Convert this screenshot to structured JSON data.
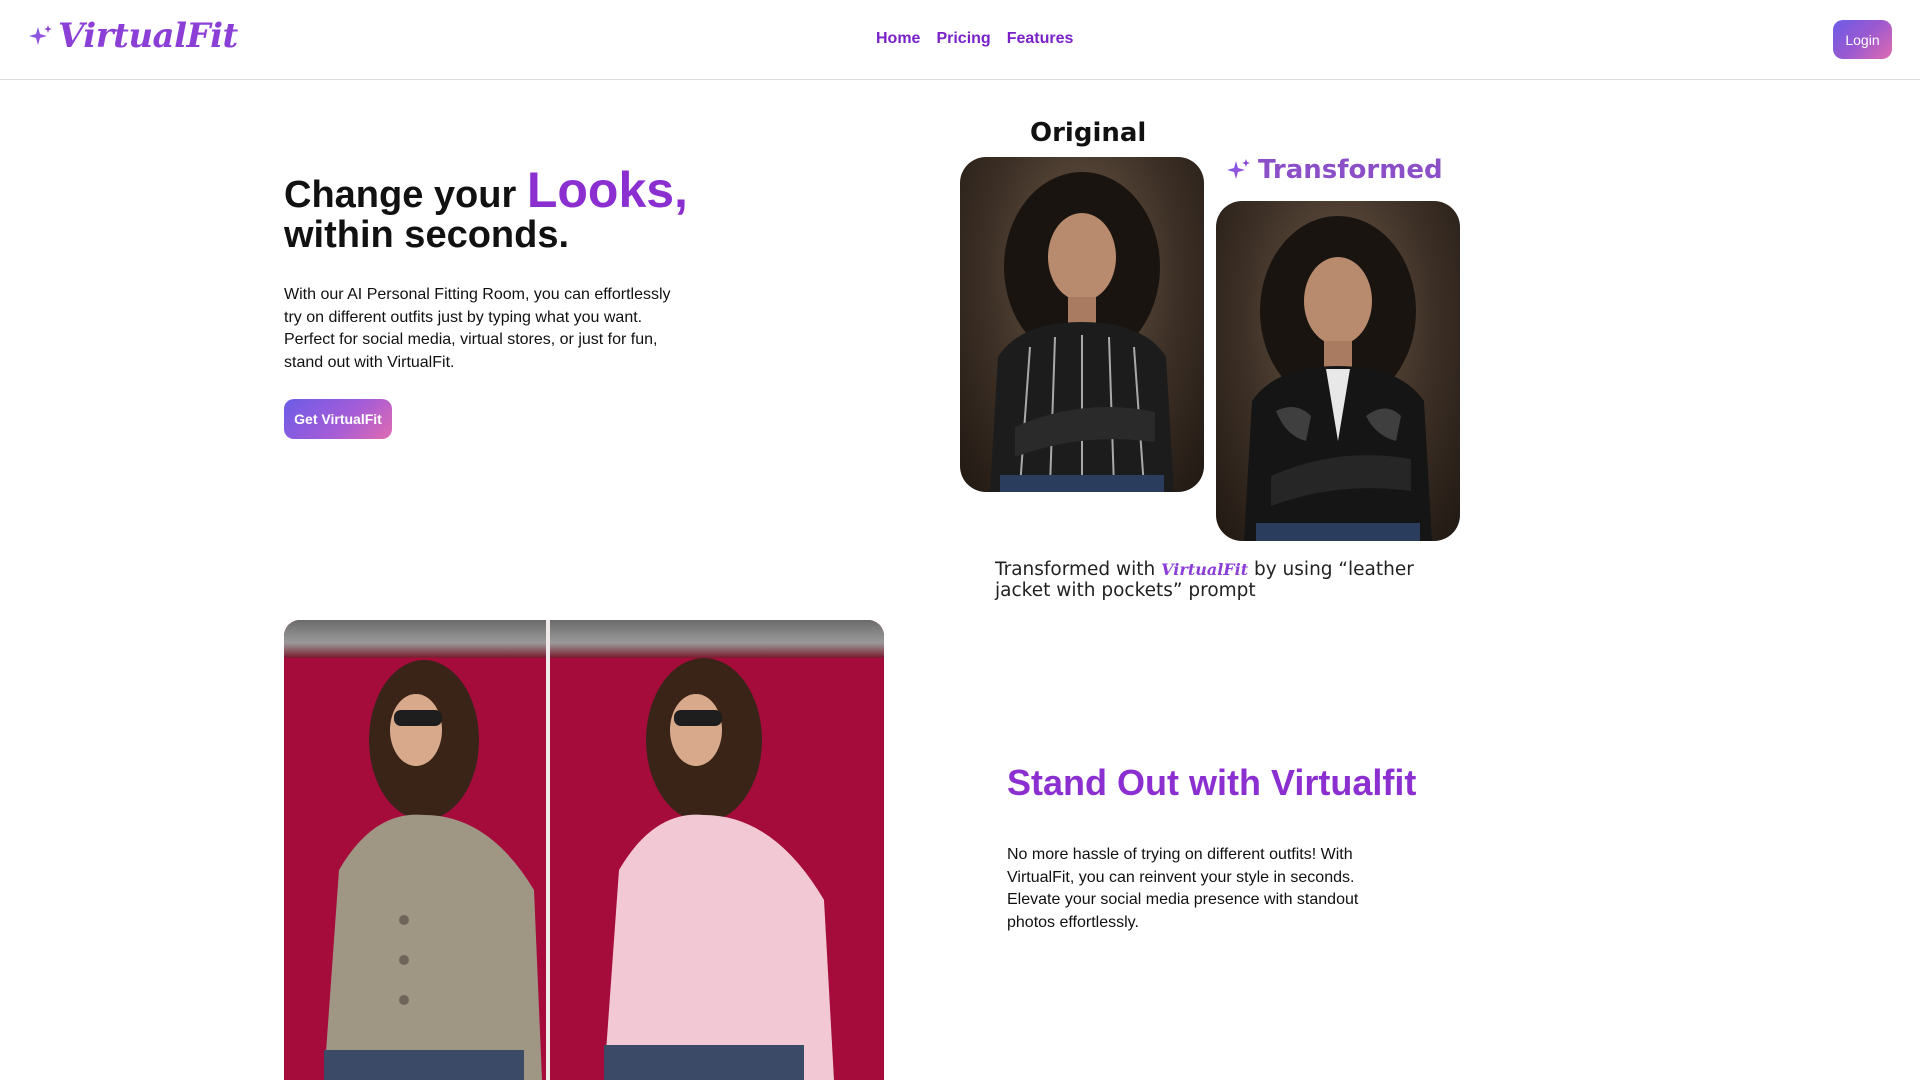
{
  "header": {
    "logo_text": "VirtualFit",
    "nav": [
      "Home",
      "Pricing",
      "Features"
    ],
    "login_label": "Login"
  },
  "hero": {
    "title_prefix": "Change your ",
    "title_highlight": "Looks,",
    "title_line2": "within seconds.",
    "description": "With our AI Personal Fitting Room, you can effortlessly try on different outfits just by typing what you want. Perfect for social media, virtual stores, or just for fun, stand out with VirtualFit.",
    "cta_label": "Get VirtualFit"
  },
  "comparison": {
    "original_label": "Original",
    "transformed_label": "Transformed",
    "caption_prefix": "Transformed with ",
    "caption_brand": "VirtualFit",
    "caption_suffix": " by using “leather jacket with pockets” prompt"
  },
  "stand_out": {
    "title": "Stand Out with Virtualfit",
    "description": "No more hassle of trying on different outfits! With VirtualFit, you can reinvent your style in seconds. Elevate your social media presence with standout photos effortlessly."
  },
  "colors": {
    "brand_purple": "#8b2fd0",
    "nav_purple": "#7a22c8",
    "gradient_start": "#6c5ce7",
    "gradient_end": "#e06bb0",
    "photo_backdrop_red": "#a50c3c"
  },
  "icons": {
    "logo": "sparkle-icon",
    "transformed": "sparkle-icon"
  }
}
